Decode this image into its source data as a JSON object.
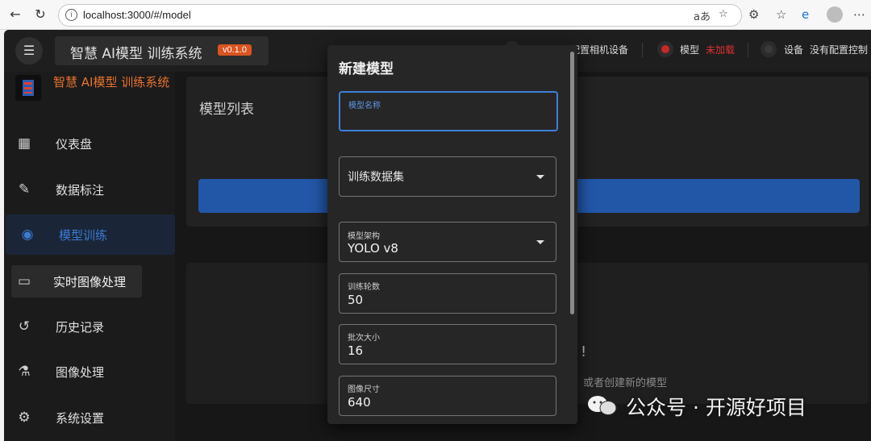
{
  "browser": {
    "url": "localhost:3000/#/model"
  },
  "appbar": {
    "title": "智慧 AI模型 训练系统",
    "version": "v0.1.0",
    "status": {
      "camera_label": "配置相机设备",
      "model_label": "模型",
      "model_value": "未加载",
      "device_label": "设备",
      "device_value": "没有配置控制"
    }
  },
  "sidebar": {
    "brand": "智慧 AI模型 训练系统",
    "items": [
      {
        "label": "仪表盘",
        "icon": "dashboard-icon"
      },
      {
        "label": "数据标注",
        "icon": "pencil-icon"
      },
      {
        "label": "模型训练",
        "icon": "training-icon"
      },
      {
        "label": "实时图像处理",
        "icon": "monitor-icon"
      },
      {
        "label": "历史记录",
        "icon": "history-icon"
      },
      {
        "label": "图像处理",
        "icon": "flask-icon"
      },
      {
        "label": "系统设置",
        "icon": "gear-icon"
      }
    ]
  },
  "main": {
    "card_title": "模型列表",
    "empty_mark": "!",
    "empty_text": "或者创建新的模型"
  },
  "dialog": {
    "title": "新建模型",
    "fields": {
      "name_label": "模型名称",
      "dataset_placeholder": "训练数据集",
      "arch_label": "模型架构",
      "arch_value": "YOLO v8",
      "epochs_label": "训练轮数",
      "epochs_value": "50",
      "batch_label": "批次大小",
      "batch_value": "16",
      "imgsize_label": "图像尺寸",
      "imgsize_value": "640"
    }
  },
  "watermark": "公众号 · 开源好项目",
  "colors": {
    "accent": "#2257a8",
    "brand_orange": "#e8722c",
    "badge": "#d9541f",
    "status_red": "#e03030"
  }
}
